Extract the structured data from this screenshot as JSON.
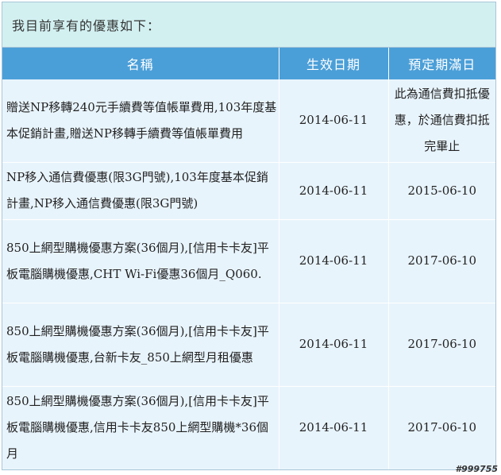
{
  "header": {
    "title": "我目前享有的優惠如下："
  },
  "table": {
    "columns": [
      "名稱",
      "生效日期",
      "預定期滿日"
    ],
    "rows": [
      {
        "name": "贈送NP移轉240元手續費等值帳單費用,103年度基本促銷計畫,贈送NP移轉手續費等值帳單費用",
        "start": "2014-06-11",
        "end": "此為通信費扣抵優惠，於通信費扣抵完畢止"
      },
      {
        "name": "NP移入通信費優惠(限3G門號),103年度基本促銷計畫,NP移入通信費優惠(限3G門號)",
        "start": "2014-06-11",
        "end": "2015-06-10"
      },
      {
        "name": "850上網型購機優惠方案(36個月),[信用卡卡友]平板電腦購機優惠,CHT Wi-Fi優惠36個月_Q060.",
        "start": "2014-06-11",
        "end": "2017-06-10"
      },
      {
        "name": "850上網型購機優惠方案(36個月),[信用卡卡友]平板電腦購機優惠,台新卡友_850上網型月租優惠",
        "start": "2014-06-11",
        "end": "2017-06-10"
      },
      {
        "name": "850上網型購機優惠方案(36個月),[信用卡卡友]平板電腦購機優惠,信用卡卡友850上網型購機*36個月",
        "start": "2014-06-11",
        "end": "2017-06-10"
      }
    ]
  },
  "watermark": "#999755",
  "colors": {
    "header_bg": "#d3f0f1",
    "column_header_bg": "#4b9fd8",
    "cell_bg": "#e8f4fc",
    "border": "#a9c6d8"
  }
}
